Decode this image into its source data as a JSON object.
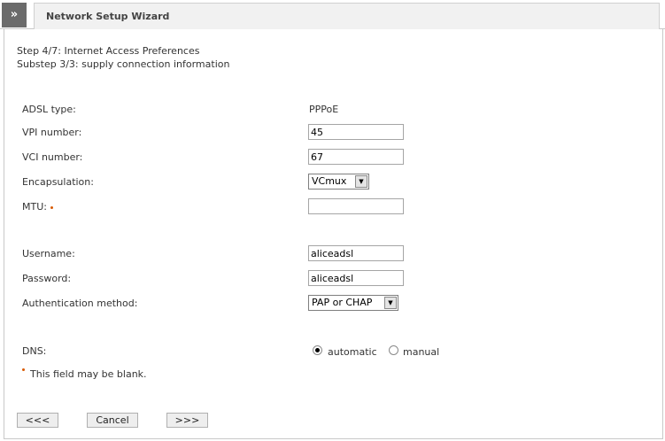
{
  "header": {
    "toggle_label": "»",
    "title": "Network Setup Wizard"
  },
  "step": {
    "line1": "Step 4/7: Internet Access Preferences",
    "line2": "Substep 3/3: supply connection information"
  },
  "form": {
    "adsl_type_label": "ADSL type:",
    "adsl_type_value": "PPPoE",
    "vpi_label": "VPI number:",
    "vpi_value": "45",
    "vci_label": "VCI number:",
    "vci_value": "67",
    "encapsulation_label": "Encapsulation:",
    "encapsulation_value": "VCmux",
    "mtu_label": "MTU:",
    "mtu_value": "",
    "username_label": "Username:",
    "username_value": "aliceadsl",
    "password_label": "Password:",
    "password_value": "aliceadsl",
    "auth_label": "Authentication method:",
    "auth_value": "PAP or CHAP",
    "dns_label": "DNS:",
    "dns_options": [
      {
        "label": "automatic",
        "selected": true
      },
      {
        "label": "manual",
        "selected": false
      }
    ],
    "blank_note": "This field may be blank."
  },
  "buttons": {
    "back_label": "<<<",
    "cancel_label": "Cancel",
    "next_label": ">>>"
  },
  "colors": {
    "required_marker": "#d95a00",
    "nav_toggle_bg": "#6b6b6b",
    "title_tab_bg": "#f1f1f1"
  }
}
